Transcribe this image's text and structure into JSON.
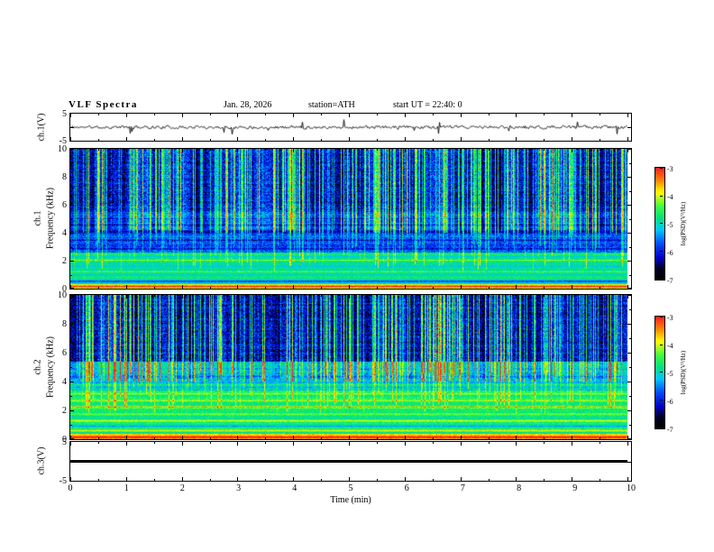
{
  "title": {
    "main": "VLF  Spectra",
    "date": "Jan. 28, 2026",
    "station": "station=ATH",
    "start_ut": "start UT =  22:40: 0"
  },
  "xaxis": {
    "label": "Time  (min)",
    "min": 0,
    "max": 10,
    "ticks": [
      "0",
      "1",
      "2",
      "3",
      "4",
      "5",
      "6",
      "7",
      "8",
      "9",
      "10"
    ]
  },
  "colorbar": {
    "label": "log(PSD)(V²/Hz)",
    "ticks": [
      "-3",
      "-4",
      "-5",
      "-6",
      "-7"
    ],
    "zmin": -7,
    "zmax": -3
  },
  "colormap": [
    {
      "v": 0.0,
      "c": "#000000"
    },
    {
      "v": 0.1,
      "c": "#000020"
    },
    {
      "v": 0.2,
      "c": "#0000c8"
    },
    {
      "v": 0.33,
      "c": "#0050ff"
    },
    {
      "v": 0.45,
      "c": "#00c8ff"
    },
    {
      "v": 0.55,
      "c": "#00e080"
    },
    {
      "v": 0.66,
      "c": "#40ff40"
    },
    {
      "v": 0.78,
      "c": "#ffff00"
    },
    {
      "v": 0.88,
      "c": "#ff9000"
    },
    {
      "v": 1.0,
      "c": "#ff2020"
    }
  ],
  "chart_data": [
    {
      "type": "line",
      "name": "ch1-voltage",
      "ylabel": "ch.1(V)",
      "ylim": [
        -5,
        5
      ],
      "yticks": [
        "5",
        "-5"
      ],
      "xlim": [
        0,
        10
      ],
      "description": "Broadband noise trace oscillating near 0 V with intermittent impulsive spikes of roughly 1-3 V (sferics)",
      "noise_amp": 0.5,
      "spike_prob": 0.02,
      "spike_amp": 2.4,
      "seed": 11
    },
    {
      "type": "heatmap",
      "name": "ch1-spectrogram",
      "ylabel_lines": [
        "ch.1",
        "Frequency  (kHz)"
      ],
      "ylim": [
        0,
        10
      ],
      "yticks": [
        "10",
        "8",
        "6",
        "4",
        "2",
        "0"
      ],
      "xlim": [
        0,
        10
      ],
      "zlabel": "log(PSD)(V²/Hz)",
      "zlim": [
        -7,
        -3
      ],
      "description": "VLF spectrogram: dark blue/black above ~5.5 kHz crossed by dense bright vertical sferic streaks; medium blue 2.6-5.5 kHz with dark horizontal interference bands; green/cyan below 2.6 kHz with bright yellow-green band near 0-0.4 kHz",
      "bands": [
        {
          "f0": 0.0,
          "f1": 0.38,
          "base": 0.74,
          "noise": 0.05
        },
        {
          "f0": 0.38,
          "f1": 2.6,
          "base": 0.52,
          "noise": 0.06
        },
        {
          "f0": 2.6,
          "f1": 5.5,
          "base": 0.32,
          "noise": 0.1
        },
        {
          "f0": 5.5,
          "f1": 10.01,
          "base": 0.22,
          "noise": 0.13
        }
      ],
      "hlines": [
        {
          "f": 0.18,
          "amp": 0.22,
          "w": 0.18
        },
        {
          "f": 0.55,
          "amp": -0.28,
          "w": 0.12
        },
        {
          "f": 0.85,
          "amp": 0.1,
          "w": 0.1
        },
        {
          "f": 1.25,
          "amp": 0.14,
          "w": 0.1
        },
        {
          "f": 1.65,
          "amp": -0.1,
          "w": 0.08
        },
        {
          "f": 2.05,
          "amp": 0.16,
          "w": 0.1
        },
        {
          "f": 2.45,
          "amp": 0.1,
          "w": 0.08
        },
        {
          "f": 2.9,
          "amp": -0.12,
          "w": 0.1
        },
        {
          "f": 3.5,
          "amp": -0.14,
          "w": 0.12
        },
        {
          "f": 4.1,
          "amp": -0.16,
          "w": 0.14
        },
        {
          "f": 4.6,
          "amp": -0.14,
          "w": 0.1
        },
        {
          "f": 5.05,
          "amp": -0.1,
          "w": 0.08
        }
      ],
      "streaks": {
        "fmin": 4.3,
        "density": 0.4,
        "amp": 0.4,
        "reach": 3.0
      },
      "colmod": 0.16,
      "seed": 7
    },
    {
      "type": "heatmap",
      "name": "ch2-spectrogram",
      "ylabel_lines": [
        "ch.2",
        "Frequency  (kHz)"
      ],
      "ylim": [
        0,
        10
      ],
      "yticks": [
        "10",
        "8",
        "6",
        "4",
        "2",
        "0"
      ],
      "xlim": [
        0,
        10
      ],
      "zlabel": "log(PSD)(V²/Hz)",
      "zlim": [
        -7,
        -3
      ],
      "description": "VLF spectrogram: dark blue/black above ~5.4 kHz with dense bright vertical sferic streaks; strong green background below ~3.4 kHz laced with bright yellow horizontal lines (power-line/tweek harmonics); bright yellow-green band near 0-0.4 kHz",
      "bands": [
        {
          "f0": 0.0,
          "f1": 0.38,
          "base": 0.8,
          "noise": 0.05
        },
        {
          "f0": 0.38,
          "f1": 3.4,
          "base": 0.58,
          "noise": 0.06
        },
        {
          "f0": 3.4,
          "f1": 5.4,
          "base": 0.46,
          "noise": 0.09
        },
        {
          "f0": 5.4,
          "f1": 10.01,
          "base": 0.21,
          "noise": 0.13
        }
      ],
      "hlines": [
        {
          "f": 0.18,
          "amp": 0.22,
          "w": 0.18
        },
        {
          "f": 0.62,
          "amp": 0.18,
          "w": 0.1
        },
        {
          "f": 0.95,
          "amp": -0.18,
          "w": 0.1
        },
        {
          "f": 1.3,
          "amp": 0.18,
          "w": 0.1
        },
        {
          "f": 1.75,
          "amp": 0.12,
          "w": 0.1
        },
        {
          "f": 2.25,
          "amp": 0.26,
          "w": 0.12
        },
        {
          "f": 2.7,
          "amp": 0.16,
          "w": 0.1
        },
        {
          "f": 3.2,
          "amp": 0.12,
          "w": 0.1
        },
        {
          "f": 3.8,
          "amp": 0.1,
          "w": 0.08
        },
        {
          "f": 4.35,
          "amp": -0.12,
          "w": 0.1
        },
        {
          "f": 4.9,
          "amp": -0.08,
          "w": 0.08
        }
      ],
      "streaks": {
        "fmin": 4.8,
        "density": 0.4,
        "amp": 0.45,
        "reach": 3.0
      },
      "colmod": 0.16,
      "seed": 23
    },
    {
      "type": "line",
      "name": "ch3-voltage",
      "ylabel": "ch.3(V)",
      "ylim": [
        -5,
        5
      ],
      "yticks": [
        "5",
        "-5"
      ],
      "xlim": [
        0,
        10
      ],
      "values_constant": 0,
      "description": "Flat thick black trace at 0 V for the full 10 minutes (channel inactive)"
    }
  ]
}
